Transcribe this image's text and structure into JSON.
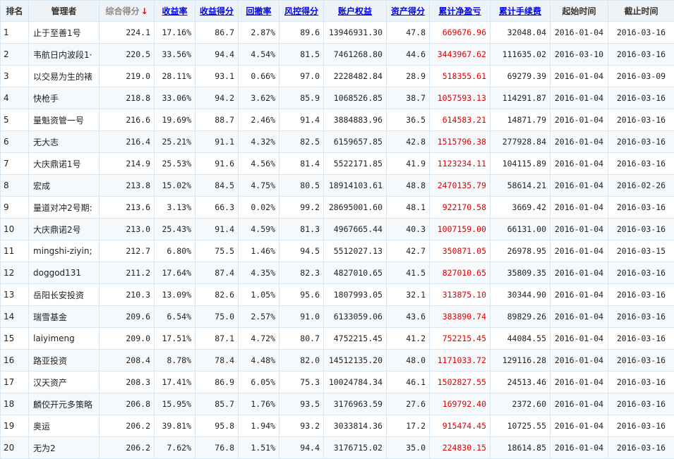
{
  "headers": {
    "rank": "排名",
    "manager": "管理者",
    "total_score": "综合得分",
    "return_rate": "收益率",
    "return_score": "收益得分",
    "drawdown": "回撤率",
    "risk_score": "风控得分",
    "equity": "账户权益",
    "asset_score": "资产得分",
    "net_pnl": "累计净盈亏",
    "fees": "累计手续费",
    "start": "起始时间",
    "end": "截止时间",
    "sort_arrow": "↓"
  },
  "rows": [
    {
      "rank": "1",
      "manager": "止于至善1号",
      "total": "224.1",
      "rate": "17.16%",
      "rscore": "86.7",
      "dd": "2.87%",
      "risk": "89.6",
      "equity": "13946931.30",
      "asset": "47.8",
      "pnl": "669676.96",
      "fee": "32048.04",
      "start": "2016-01-04",
      "end": "2016-03-16"
    },
    {
      "rank": "2",
      "manager": "韦航日内波段1·",
      "total": "220.5",
      "rate": "33.56%",
      "rscore": "94.4",
      "dd": "4.54%",
      "risk": "81.5",
      "equity": "7461268.80",
      "asset": "44.6",
      "pnl": "3443967.62",
      "fee": "111635.02",
      "start": "2016-03-10",
      "end": "2016-03-16"
    },
    {
      "rank": "3",
      "manager": "以交易为生的裱",
      "total": "219.0",
      "rate": "28.11%",
      "rscore": "93.1",
      "dd": "0.66%",
      "risk": "97.0",
      "equity": "2228482.84",
      "asset": "28.9",
      "pnl": "518355.61",
      "fee": "69279.39",
      "start": "2016-01-04",
      "end": "2016-03-09"
    },
    {
      "rank": "4",
      "manager": "快枪手",
      "total": "218.8",
      "rate": "33.06%",
      "rscore": "94.2",
      "dd": "3.62%",
      "risk": "85.9",
      "equity": "1068526.85",
      "asset": "38.7",
      "pnl": "1057593.13",
      "fee": "114291.87",
      "start": "2016-01-04",
      "end": "2016-03-16"
    },
    {
      "rank": "5",
      "manager": "量魁资管一号",
      "total": "216.6",
      "rate": "19.69%",
      "rscore": "88.7",
      "dd": "2.46%",
      "risk": "91.4",
      "equity": "3884883.96",
      "asset": "36.5",
      "pnl": "614583.21",
      "fee": "14871.79",
      "start": "2016-01-04",
      "end": "2016-03-16"
    },
    {
      "rank": "6",
      "manager": "无大志",
      "total": "216.4",
      "rate": "25.21%",
      "rscore": "91.1",
      "dd": "4.32%",
      "risk": "82.5",
      "equity": "6159657.85",
      "asset": "42.8",
      "pnl": "1515796.38",
      "fee": "277928.84",
      "start": "2016-01-04",
      "end": "2016-03-16"
    },
    {
      "rank": "7",
      "manager": "大庆鼎诺1号",
      "total": "214.9",
      "rate": "25.53%",
      "rscore": "91.6",
      "dd": "4.56%",
      "risk": "81.4",
      "equity": "5522171.85",
      "asset": "41.9",
      "pnl": "1123234.11",
      "fee": "104115.89",
      "start": "2016-01-04",
      "end": "2016-03-16"
    },
    {
      "rank": "8",
      "manager": "宏成",
      "total": "213.8",
      "rate": "15.02%",
      "rscore": "84.5",
      "dd": "4.75%",
      "risk": "80.5",
      "equity": "18914103.61",
      "asset": "48.8",
      "pnl": "2470135.79",
      "fee": "58614.21",
      "start": "2016-01-04",
      "end": "2016-02-26"
    },
    {
      "rank": "9",
      "manager": "量道对冲2号期:",
      "total": "213.6",
      "rate": "3.13%",
      "rscore": "66.3",
      "dd": "0.02%",
      "risk": "99.2",
      "equity": "28695001.60",
      "asset": "48.1",
      "pnl": "922170.58",
      "fee": "3669.42",
      "start": "2016-01-04",
      "end": "2016-03-16"
    },
    {
      "rank": "10",
      "manager": "大庆鼎诺2号",
      "total": "213.0",
      "rate": "25.43%",
      "rscore": "91.4",
      "dd": "4.59%",
      "risk": "81.3",
      "equity": "4967665.44",
      "asset": "40.3",
      "pnl": "1007159.00",
      "fee": "66131.00",
      "start": "2016-01-04",
      "end": "2016-03-16"
    },
    {
      "rank": "11",
      "manager": "mingshi-ziyin;",
      "total": "212.7",
      "rate": "6.80%",
      "rscore": "75.5",
      "dd": "1.46%",
      "risk": "94.5",
      "equity": "5512027.13",
      "asset": "42.7",
      "pnl": "350871.05",
      "fee": "26978.95",
      "start": "2016-01-04",
      "end": "2016-03-15"
    },
    {
      "rank": "12",
      "manager": "doggod131",
      "total": "211.2",
      "rate": "17.64%",
      "rscore": "87.4",
      "dd": "4.35%",
      "risk": "82.3",
      "equity": "4827010.65",
      "asset": "41.5",
      "pnl": "827010.65",
      "fee": "35809.35",
      "start": "2016-01-04",
      "end": "2016-03-16"
    },
    {
      "rank": "13",
      "manager": "岳阳长安投资",
      "total": "210.3",
      "rate": "13.09%",
      "rscore": "82.6",
      "dd": "1.05%",
      "risk": "95.6",
      "equity": "1807993.05",
      "asset": "32.1",
      "pnl": "313875.10",
      "fee": "30344.90",
      "start": "2016-01-04",
      "end": "2016-03-16"
    },
    {
      "rank": "14",
      "manager": "瑞雪基金",
      "total": "209.6",
      "rate": "6.54%",
      "rscore": "75.0",
      "dd": "2.57%",
      "risk": "91.0",
      "equity": "6133059.06",
      "asset": "43.6",
      "pnl": "383890.74",
      "fee": "89829.26",
      "start": "2016-01-04",
      "end": "2016-03-16"
    },
    {
      "rank": "15",
      "manager": "laiyimeng",
      "total": "209.0",
      "rate": "17.51%",
      "rscore": "87.1",
      "dd": "4.72%",
      "risk": "80.7",
      "equity": "4752215.45",
      "asset": "41.2",
      "pnl": "752215.45",
      "fee": "44084.55",
      "start": "2016-01-04",
      "end": "2016-03-16"
    },
    {
      "rank": "16",
      "manager": "路亚投资",
      "total": "208.4",
      "rate": "8.78%",
      "rscore": "78.4",
      "dd": "4.48%",
      "risk": "82.0",
      "equity": "14512135.20",
      "asset": "48.0",
      "pnl": "1171033.72",
      "fee": "129116.28",
      "start": "2016-01-04",
      "end": "2016-03-16"
    },
    {
      "rank": "17",
      "manager": "汉天资产",
      "total": "208.3",
      "rate": "17.41%",
      "rscore": "86.9",
      "dd": "6.05%",
      "risk": "75.3",
      "equity": "10024784.34",
      "asset": "46.1",
      "pnl": "1502827.55",
      "fee": "24513.46",
      "start": "2016-01-04",
      "end": "2016-03-16"
    },
    {
      "rank": "18",
      "manager": "麟佼开元多策略",
      "total": "206.8",
      "rate": "15.95%",
      "rscore": "85.7",
      "dd": "1.76%",
      "risk": "93.5",
      "equity": "3176963.59",
      "asset": "27.6",
      "pnl": "169792.40",
      "fee": "2372.60",
      "start": "2016-01-04",
      "end": "2016-03-16"
    },
    {
      "rank": "19",
      "manager": "奥运",
      "total": "206.2",
      "rate": "39.81%",
      "rscore": "95.8",
      "dd": "1.94%",
      "risk": "93.2",
      "equity": "3033814.36",
      "asset": "17.2",
      "pnl": "915474.45",
      "fee": "10725.55",
      "start": "2016-01-04",
      "end": "2016-03-16"
    },
    {
      "rank": "20",
      "manager": "无为2",
      "total": "206.2",
      "rate": "7.62%",
      "rscore": "76.8",
      "dd": "1.51%",
      "risk": "94.4",
      "equity": "3176715.02",
      "asset": "35.0",
      "pnl": "224830.15",
      "fee": "18614.85",
      "start": "2016-01-04",
      "end": "2016-03-16"
    }
  ]
}
